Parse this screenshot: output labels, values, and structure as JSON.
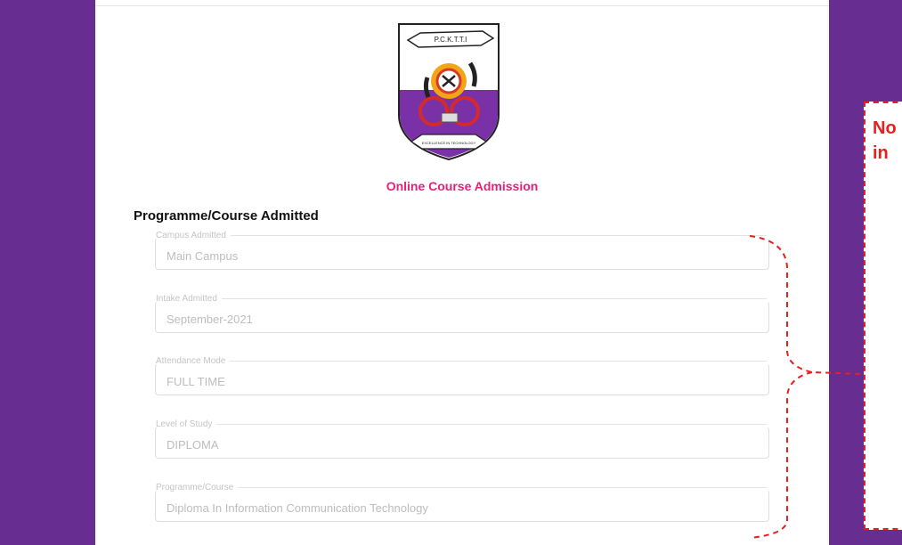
{
  "header": {
    "logo_text_top": "P.C.K.T.T.I",
    "logo_motto": "EXCELLENCE IN TECHNOLOGY",
    "form_title": "Online Course Admission"
  },
  "section": {
    "title": "Programme/Course Admitted",
    "fields": [
      {
        "label": "Campus Admitted",
        "value": "Main Campus"
      },
      {
        "label": "Intake Admitted",
        "value": "September-2021"
      },
      {
        "label": "Attendance Mode",
        "value": "FULL TIME"
      },
      {
        "label": "Level of Study",
        "value": "DIPLOMA"
      },
      {
        "label": "Programme/Course",
        "value": "Diploma In Information Communication Technology"
      }
    ]
  },
  "callout": {
    "line1": "No",
    "line2": "in"
  },
  "colors": {
    "background": "#672d91",
    "accent": "#e0237a",
    "annotation": "#e5201f"
  }
}
